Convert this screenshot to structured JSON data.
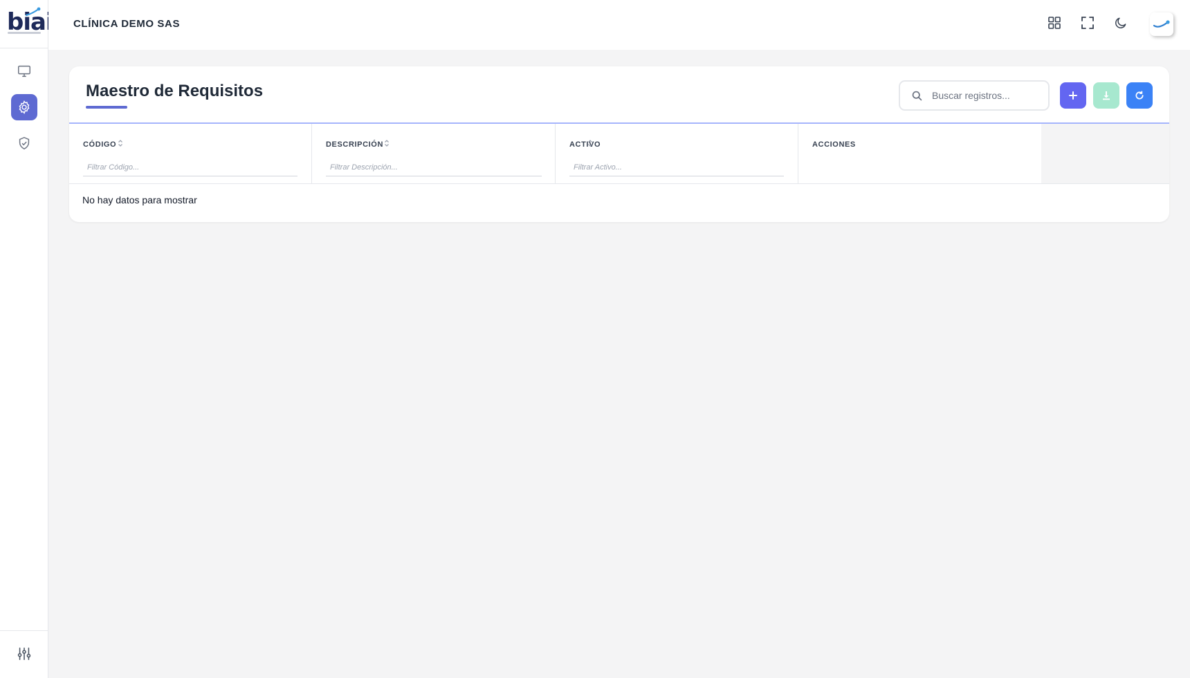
{
  "app": {
    "logo_text": "biai",
    "org_name": "CLÍNICA DEMO SAS"
  },
  "sidebar": {
    "items": [
      {
        "name": "monitor-icon",
        "active": false
      },
      {
        "name": "gear-icon",
        "active": true
      },
      {
        "name": "shield-check-icon",
        "active": false
      }
    ],
    "bottom_item": {
      "name": "sliders-icon"
    }
  },
  "header": {
    "icons": [
      "grid-icon",
      "fullscreen-icon",
      "moon-icon"
    ],
    "avatar_icon": "brand-swoosh-icon"
  },
  "page": {
    "title": "Maestro de Requisitos",
    "search": {
      "placeholder": "Buscar registros...",
      "value": ""
    },
    "toolbar": {
      "add_icon": "plus-icon",
      "export_icon": "download-icon",
      "refresh_icon": "refresh-icon"
    }
  },
  "table": {
    "columns": [
      {
        "label": "CÓDIGO",
        "filter_placeholder": "Filtrar Código...",
        "sortable": true
      },
      {
        "label": "DESCRIPCIÓN",
        "filter_placeholder": "Filtrar Descripción...",
        "sortable": true
      },
      {
        "label": "ACTIVO",
        "filter_placeholder": "Filtrar Activo...",
        "sortable": true
      },
      {
        "label": "ACCIONES",
        "sortable": false
      }
    ],
    "rows": [],
    "empty_message": "No hay datos para mostrar"
  },
  "colors": {
    "primary": "#5e6ad2",
    "add_button": "#6366f1",
    "export_button": "#a7e8cf",
    "refresh_button": "#3b82f6",
    "background": "#f4f4f5"
  }
}
